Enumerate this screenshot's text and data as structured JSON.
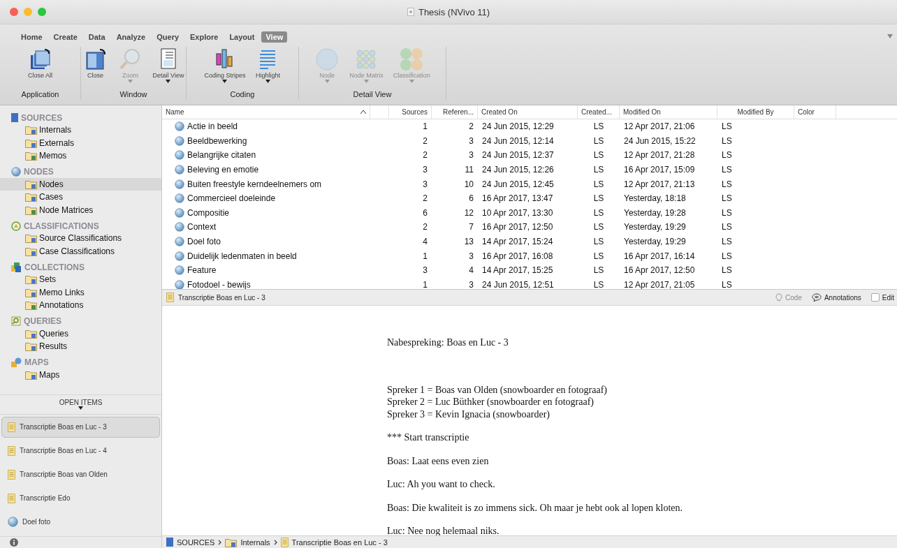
{
  "window": {
    "title": "Thesis (NVivo 11)"
  },
  "ribbon": {
    "tabs": [
      {
        "label": "Home",
        "selected": false
      },
      {
        "label": "Create",
        "selected": false
      },
      {
        "label": "Data",
        "selected": false
      },
      {
        "label": "Analyze",
        "selected": false
      },
      {
        "label": "Query",
        "selected": false
      },
      {
        "label": "Explore",
        "selected": false
      },
      {
        "label": "Layout",
        "selected": false
      },
      {
        "label": "View",
        "selected": true
      }
    ],
    "groups": [
      {
        "label": "Application",
        "buttons": [
          {
            "label": "Close All",
            "kind": "stack",
            "disabled": false,
            "dropdown": false
          }
        ]
      },
      {
        "label": "Window",
        "buttons": [
          {
            "label": "Close",
            "kind": "window",
            "disabled": false,
            "dropdown": false
          },
          {
            "label": "Zoom",
            "kind": "magnifier",
            "disabled": true,
            "dropdown": true
          },
          {
            "label": "Detail View",
            "kind": "detail",
            "disabled": false,
            "dropdown": true
          }
        ]
      },
      {
        "label": "Coding",
        "buttons": [
          {
            "label": "Coding Stripes",
            "kind": "stripes",
            "disabled": false,
            "dropdown": true
          },
          {
            "label": "Highlight",
            "kind": "lines",
            "disabled": false,
            "dropdown": true
          }
        ]
      },
      {
        "label": "Detail View",
        "buttons": [
          {
            "label": "Node",
            "kind": "sphere",
            "disabled": true,
            "dropdown": true
          },
          {
            "label": "Node Matrix",
            "kind": "grid",
            "disabled": true,
            "dropdown": true
          },
          {
            "label": "Classification",
            "kind": "circles",
            "disabled": true,
            "dropdown": true
          }
        ]
      }
    ]
  },
  "sidebar": {
    "sections": [
      {
        "title": "SOURCES",
        "kind": "sources",
        "items": [
          {
            "label": "Internals",
            "selected": false
          },
          {
            "label": "Externals",
            "selected": false
          },
          {
            "label": "Memos",
            "selected": false
          }
        ]
      },
      {
        "title": "NODES",
        "kind": "nodes",
        "items": [
          {
            "label": "Nodes",
            "selected": true
          },
          {
            "label": "Cases",
            "selected": false
          },
          {
            "label": "Node Matrices",
            "selected": false
          }
        ]
      },
      {
        "title": "CLASSIFICATIONS",
        "kind": "classifications",
        "items": [
          {
            "label": "Source Classifications",
            "selected": false
          },
          {
            "label": "Case Classifications",
            "selected": false
          }
        ]
      },
      {
        "title": "COLLECTIONS",
        "kind": "collections",
        "items": [
          {
            "label": "Sets",
            "selected": false
          },
          {
            "label": "Memo Links",
            "selected": false
          },
          {
            "label": "Annotations",
            "selected": false
          }
        ]
      },
      {
        "title": "QUERIES",
        "kind": "queries",
        "items": [
          {
            "label": "Queries",
            "selected": false
          },
          {
            "label": "Results",
            "selected": false
          }
        ]
      },
      {
        "title": "MAPS",
        "kind": "maps",
        "items": [
          {
            "label": "Maps",
            "selected": false
          }
        ]
      }
    ]
  },
  "open_items": {
    "title": "OPEN ITEMS",
    "items": [
      {
        "label": "Transcriptie Boas en Luc - 3",
        "kind": "document",
        "selected": true
      },
      {
        "label": "Transcriptie Boas en Luc - 4",
        "kind": "document",
        "selected": false
      },
      {
        "label": "Transcriptie Boas van Olden",
        "kind": "document",
        "selected": false
      },
      {
        "label": "Transcriptie Edo",
        "kind": "document",
        "selected": false
      },
      {
        "label": "Doel foto",
        "kind": "node",
        "selected": false
      }
    ]
  },
  "table": {
    "columns": [
      "Name",
      "Sources",
      "Referen...",
      "Created On",
      "Created...",
      "Modified On",
      "Modified By",
      "Color"
    ],
    "sorted_ascending": true,
    "rows": [
      [
        "Actie in beeld",
        "1",
        "2",
        "24 Jun 2015, 12:29",
        "LS",
        "12 Apr 2017, 21:06",
        "LS"
      ],
      [
        "Beeldbewerking",
        "2",
        "3",
        "24 Jun 2015, 12:14",
        "LS",
        "24 Jun 2015, 15:22",
        "LS"
      ],
      [
        "Belangrijke citaten",
        "2",
        "3",
        "24 Jun 2015, 12:37",
        "LS",
        "12 Apr 2017, 21:28",
        "LS"
      ],
      [
        "Beleving en emotie",
        "3",
        "11",
        "24 Jun 2015, 12:26",
        "LS",
        "16 Apr 2017, 15:09",
        "LS"
      ],
      [
        "Buiten freestyle kerndeelnemers om",
        "3",
        "10",
        "24 Jun 2015, 12:45",
        "LS",
        "12 Apr 2017, 21:13",
        "LS"
      ],
      [
        "Commercieel doeleinde",
        "2",
        "6",
        "16 Apr 2017, 13:47",
        "LS",
        "Yesterday, 18:18",
        "LS"
      ],
      [
        "Compositie",
        "6",
        "12",
        "10 Apr 2017, 13:30",
        "LS",
        "Yesterday, 19:28",
        "LS"
      ],
      [
        "Context",
        "2",
        "7",
        "16 Apr 2017, 12:50",
        "LS",
        "Yesterday, 19:29",
        "LS"
      ],
      [
        "Doel foto",
        "4",
        "13",
        "14 Apr 2017, 15:24",
        "LS",
        "Yesterday, 19:29",
        "LS"
      ],
      [
        "Duidelijk ledenmaten in beeld",
        "1",
        "3",
        "16 Apr 2017, 16:08",
        "LS",
        "16 Apr 2017, 16:14",
        "LS"
      ],
      [
        "Feature",
        "3",
        "4",
        "14 Apr 2017, 15:25",
        "LS",
        "16 Apr 2017, 12:50",
        "LS"
      ],
      [
        "Fotodoel - bewijs",
        "1",
        "3",
        "24 Jun 2015, 12:51",
        "LS",
        "12 Apr 2017, 21:05",
        "LS"
      ]
    ]
  },
  "document": {
    "title": "Transcriptie Boas en Luc - 3",
    "code": {
      "label": "Code",
      "disabled": true
    },
    "annotations": {
      "label": "Annotations"
    },
    "edit": {
      "label": "Edit",
      "checked": false
    },
    "blocks": [
      {
        "kind": "heading",
        "lines": [
          "Nabespreking: Boas en Luc - 3"
        ]
      },
      {
        "kind": "paragraph",
        "lines": [
          "Spreker 1 = Boas van Olden (snowboarder en fotograaf)",
          "Spreker 2 = Luc Büthker (snowboarder en fotograaf)",
          "Spreker 3 = Kevin Ignacia (snowboarder)"
        ]
      },
      {
        "kind": "paragraph",
        "lines": [
          "*** Start transcriptie"
        ]
      },
      {
        "kind": "paragraph",
        "lines": [
          "Boas: Laat eens even zien"
        ]
      },
      {
        "kind": "paragraph",
        "lines": [
          "Luc: Ah you want to check."
        ]
      },
      {
        "kind": "paragraph",
        "lines": [
          "Boas: Die kwaliteit is zo immens sick. Oh maar je hebt ook al lopen kloten."
        ]
      },
      {
        "kind": "paragraph",
        "lines": [
          "Luc: Nee nog helemaal niks."
        ]
      }
    ]
  },
  "breadcrumb": [
    {
      "label": "SOURCES",
      "kind": "sources"
    },
    {
      "label": "Internals",
      "kind": "folder"
    },
    {
      "label": "Transcriptie Boas en Luc - 3",
      "kind": "document"
    }
  ]
}
